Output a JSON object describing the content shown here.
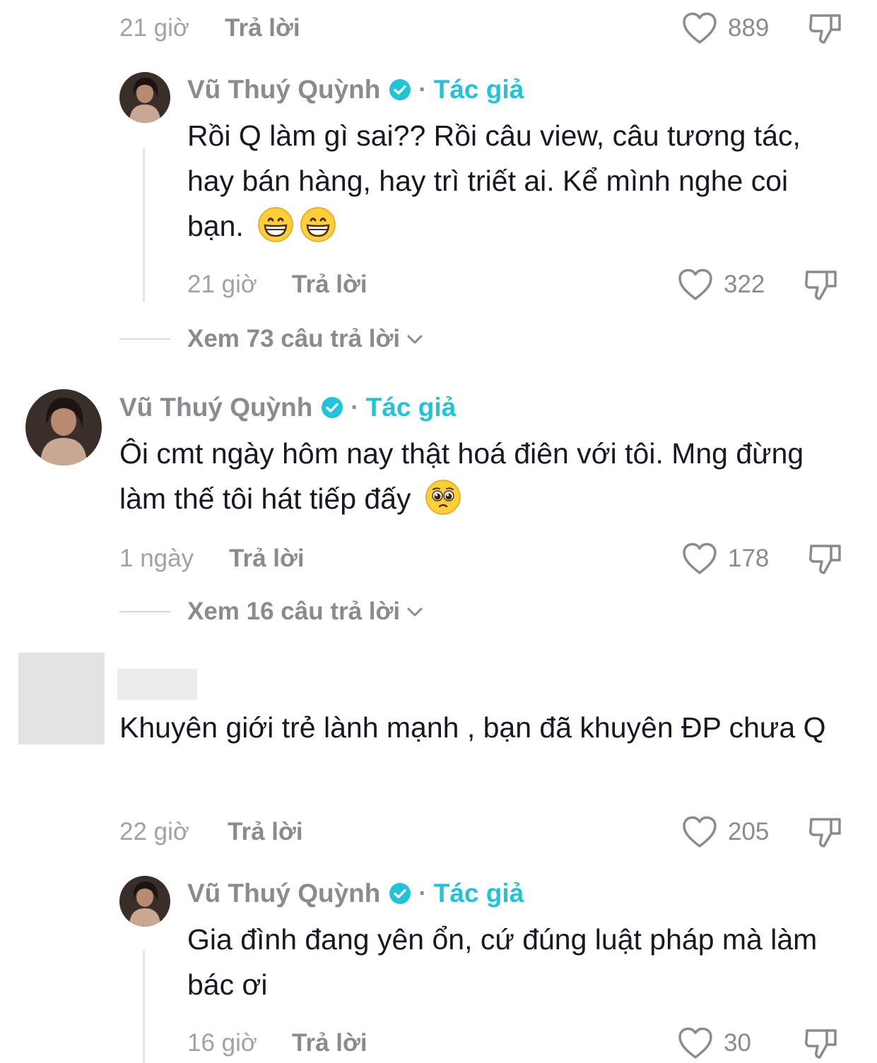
{
  "colors": {
    "text": "#161823",
    "muted": "#8a8b91",
    "author_tag": "#20c4d8",
    "verified": "#20c4d8"
  },
  "common": {
    "reply_label": "Trả lời",
    "author_tag": "Tác giả",
    "separator": "·"
  },
  "top_row": {
    "time": "21 giờ",
    "likes": "889"
  },
  "reply1": {
    "user": "Vũ Thuý Quỳnh",
    "text": "Rồi Q làm gì sai?? Rồi câu view, câu tương tác, hay bán hàng, hay trì triết ai. Kể mình nghe coi bạn.",
    "emojis": [
      "grinning-face-emoji",
      "grinning-face-emoji"
    ],
    "time": "21 giờ",
    "likes": "322"
  },
  "view_replies_1": "Xem 73 câu trả lời",
  "comment2": {
    "user": "Vũ Thuý Quỳnh",
    "text": "Ôi cmt ngày hôm nay thật hoá điên với tôi. Mng đừng làm thế tôi hát tiếp đấy",
    "emojis": [
      "pleading-face-emoji"
    ],
    "time": "1 ngày",
    "likes": "178"
  },
  "view_replies_2": "Xem 16 câu trả lời",
  "comment3": {
    "text": "Khuyên giới trẻ lành mạnh , bạn đã khuyên ĐP chưa Q",
    "time": "22 giờ",
    "likes": "205"
  },
  "reply3": {
    "user": "Vũ Thuý Quỳnh",
    "text": "Gia đình đang yên ổn, cứ đúng luật pháp mà làm bác ơi",
    "time": "16 giờ",
    "likes": "30"
  }
}
